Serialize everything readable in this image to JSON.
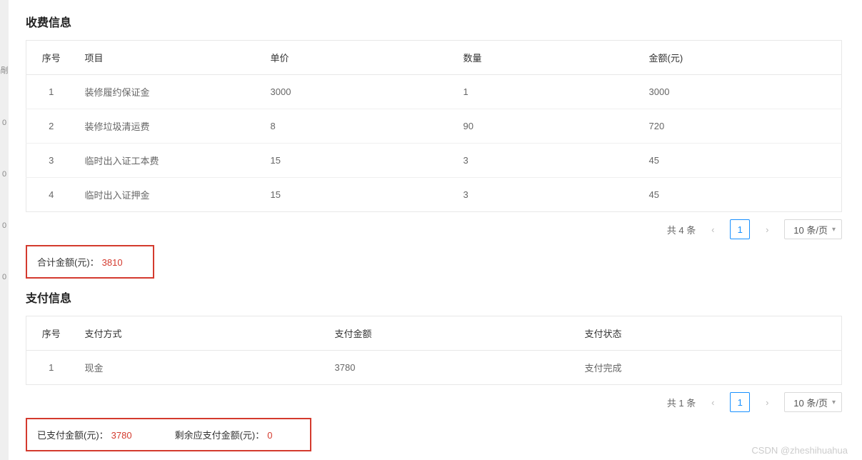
{
  "leftStrip": [
    "剮",
    "0",
    "0",
    "0",
    "0"
  ],
  "fee": {
    "title": "收费信息",
    "headers": {
      "idx": "序号",
      "item": "项目",
      "price": "单价",
      "qty": "数量",
      "amt": "金额(元)"
    },
    "rows": [
      {
        "idx": "1",
        "item": "装修履约保证金",
        "price": "3000",
        "qty": "1",
        "amt": "3000"
      },
      {
        "idx": "2",
        "item": "装修垃圾清运费",
        "price": "8",
        "qty": "90",
        "amt": "720"
      },
      {
        "idx": "3",
        "item": "临时出入证工本费",
        "price": "15",
        "qty": "3",
        "amt": "45"
      },
      {
        "idx": "4",
        "item": "临时出入证押金",
        "price": "15",
        "qty": "3",
        "amt": "45"
      }
    ],
    "total_label": "合计金额(元)：",
    "total_value": "3810",
    "pagination": {
      "total": "共 4 条",
      "page": "1",
      "pagesize": "10 条/页"
    }
  },
  "pay": {
    "title": "支付信息",
    "headers": {
      "idx": "序号",
      "method": "支付方式",
      "amt": "支付金额",
      "status": "支付状态"
    },
    "rows": [
      {
        "idx": "1",
        "method": "现金",
        "amt": "3780",
        "status": "支付完成"
      }
    ],
    "paid_label": "已支付金额(元)：",
    "paid_value": "3780",
    "remain_label": "剩余应支付金额(元)：",
    "remain_value": "0",
    "pagination": {
      "total": "共 1 条",
      "page": "1",
      "pagesize": "10 条/页"
    }
  },
  "watermark": "CSDN @zheshihuahua"
}
